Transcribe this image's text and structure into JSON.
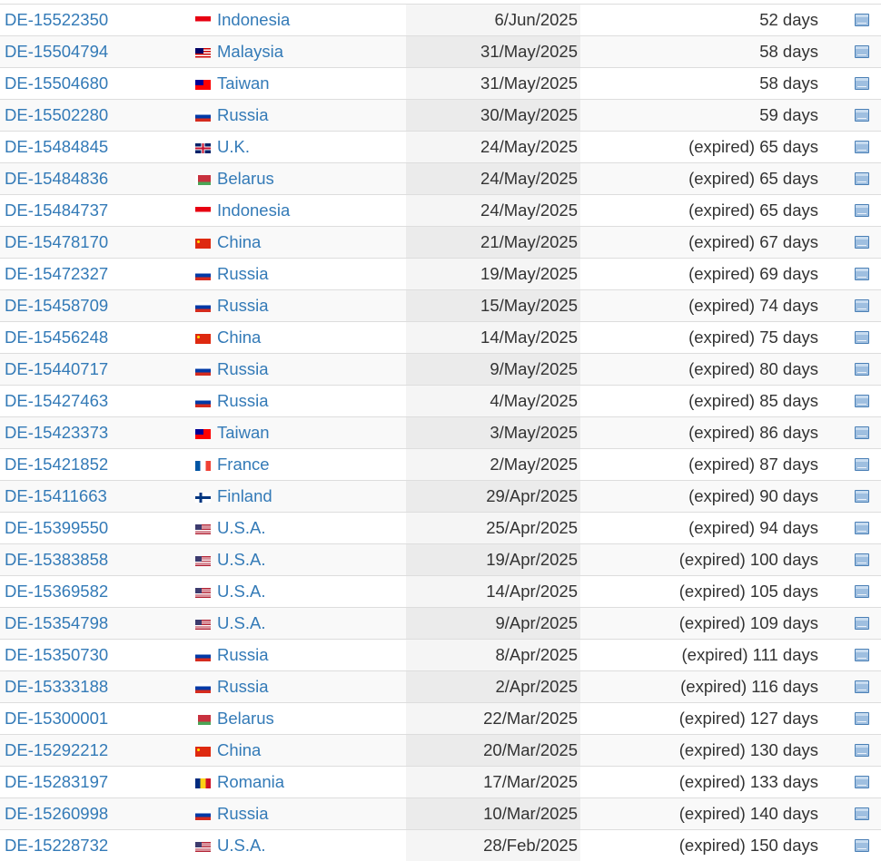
{
  "rows": [
    {
      "id": "DE-15522350",
      "country": "Indonesia",
      "flag": "id",
      "date": "6/Jun/2025",
      "days": "52 days"
    },
    {
      "id": "DE-15504794",
      "country": "Malaysia",
      "flag": "my",
      "date": "31/May/2025",
      "days": "58 days"
    },
    {
      "id": "DE-15504680",
      "country": "Taiwan",
      "flag": "tw",
      "date": "31/May/2025",
      "days": "58 days"
    },
    {
      "id": "DE-15502280",
      "country": "Russia",
      "flag": "ru",
      "date": "30/May/2025",
      "days": "59 days"
    },
    {
      "id": "DE-15484845",
      "country": "U.K.",
      "flag": "uk",
      "date": "24/May/2025",
      "days": "(expired) 65 days"
    },
    {
      "id": "DE-15484836",
      "country": "Belarus",
      "flag": "by",
      "date": "24/May/2025",
      "days": "(expired) 65 days"
    },
    {
      "id": "DE-15484737",
      "country": "Indonesia",
      "flag": "id",
      "date": "24/May/2025",
      "days": "(expired) 65 days"
    },
    {
      "id": "DE-15478170",
      "country": "China",
      "flag": "cn",
      "date": "21/May/2025",
      "days": "(expired) 67 days"
    },
    {
      "id": "DE-15472327",
      "country": "Russia",
      "flag": "ru",
      "date": "19/May/2025",
      "days": "(expired) 69 days"
    },
    {
      "id": "DE-15458709",
      "country": "Russia",
      "flag": "ru",
      "date": "15/May/2025",
      "days": "(expired) 74 days"
    },
    {
      "id": "DE-15456248",
      "country": "China",
      "flag": "cn",
      "date": "14/May/2025",
      "days": "(expired) 75 days"
    },
    {
      "id": "DE-15440717",
      "country": "Russia",
      "flag": "ru",
      "date": "9/May/2025",
      "days": "(expired) 80 days"
    },
    {
      "id": "DE-15427463",
      "country": "Russia",
      "flag": "ru",
      "date": "4/May/2025",
      "days": "(expired) 85 days"
    },
    {
      "id": "DE-15423373",
      "country": "Taiwan",
      "flag": "tw",
      "date": "3/May/2025",
      "days": "(expired) 86 days"
    },
    {
      "id": "DE-15421852",
      "country": "France",
      "flag": "fr",
      "date": "2/May/2025",
      "days": "(expired) 87 days"
    },
    {
      "id": "DE-15411663",
      "country": "Finland",
      "flag": "fi",
      "date": "29/Apr/2025",
      "days": "(expired) 90 days"
    },
    {
      "id": "DE-15399550",
      "country": "U.S.A.",
      "flag": "us",
      "date": "25/Apr/2025",
      "days": "(expired) 94 days"
    },
    {
      "id": "DE-15383858",
      "country": "U.S.A.",
      "flag": "us",
      "date": "19/Apr/2025",
      "days": "(expired) 100 days"
    },
    {
      "id": "DE-15369582",
      "country": "U.S.A.",
      "flag": "us",
      "date": "14/Apr/2025",
      "days": "(expired) 105 days"
    },
    {
      "id": "DE-15354798",
      "country": "U.S.A.",
      "flag": "us",
      "date": "9/Apr/2025",
      "days": "(expired) 109 days"
    },
    {
      "id": "DE-15350730",
      "country": "Russia",
      "flag": "ru",
      "date": "8/Apr/2025",
      "days": "(expired) 111 days"
    },
    {
      "id": "DE-15333188",
      "country": "Russia",
      "flag": "ru",
      "date": "2/Apr/2025",
      "days": "(expired) 116 days"
    },
    {
      "id": "DE-15300001",
      "country": "Belarus",
      "flag": "by",
      "date": "22/Mar/2025",
      "days": "(expired) 127 days"
    },
    {
      "id": "DE-15292212",
      "country": "China",
      "flag": "cn",
      "date": "20/Mar/2025",
      "days": "(expired) 130 days"
    },
    {
      "id": "DE-15283197",
      "country": "Romania",
      "flag": "ro",
      "date": "17/Mar/2025",
      "days": "(expired) 133 days"
    },
    {
      "id": "DE-15260998",
      "country": "Russia",
      "flag": "ru",
      "date": "10/Mar/2025",
      "days": "(expired) 140 days"
    },
    {
      "id": "DE-15228732",
      "country": "U.S.A.",
      "flag": "us",
      "date": "28/Feb/2025",
      "days": "(expired) 150 days"
    }
  ],
  "icon": "details-icon",
  "colors": {
    "link": "#337ab7",
    "text": "#333333",
    "border": "#dddddd",
    "row_alt": "#f9f9f9"
  }
}
